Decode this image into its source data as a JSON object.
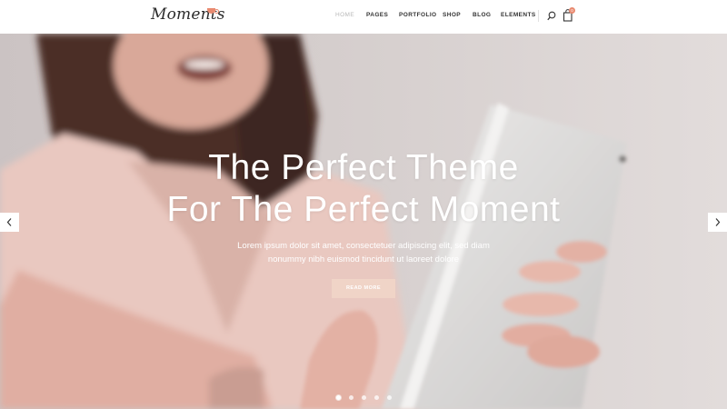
{
  "header": {
    "logo": "Moments",
    "nav": [
      {
        "label": "HOME",
        "active": true
      },
      {
        "label": "PAGES",
        "active": false
      },
      {
        "label": "PORTFOLIO",
        "active": false
      },
      {
        "label": "SHOP",
        "active": false
      },
      {
        "label": "BLOG",
        "active": false
      },
      {
        "label": "ELEMENTS",
        "active": false
      }
    ],
    "cart_count": "0",
    "icons": [
      "search-icon",
      "shopping-bag-icon"
    ]
  },
  "hero": {
    "title_line1": "The Perfect Theme",
    "title_line2": "For The Perfect Moment",
    "text_line1": "Lorem ipsum dolor sit amet, consectetuer adipiscing elit, sed diam",
    "text_line2": "nonummy nibh euismod tincidunt ut laoreet dolore",
    "button_label": "READ MORE",
    "slide_count": 5,
    "active_slide": 1,
    "icons": [
      "chevron-left-icon",
      "chevron-right-icon"
    ]
  },
  "colors": {
    "accent": "#e98a70",
    "button_bg": "#f0d4c7",
    "header_bg": "#ffffff",
    "nav_text": "#333333",
    "nav_active": "#b9b9b9"
  }
}
